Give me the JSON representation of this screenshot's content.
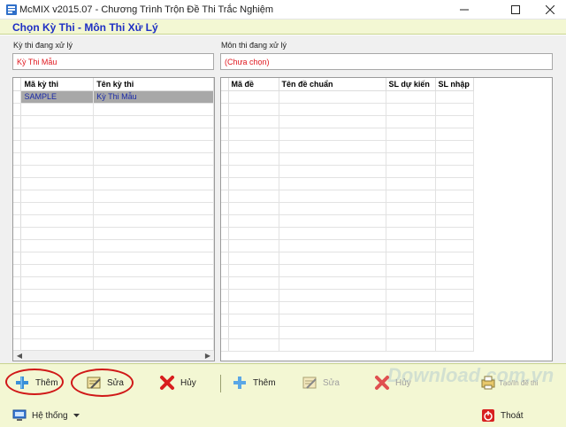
{
  "window": {
    "title": "McMIX v2015.07 - Chương Trình Trộn Đề Thi Trắc Nghiệm",
    "controls": [
      "minimize",
      "maximize",
      "close"
    ]
  },
  "header": {
    "title": "Chọn Kỳ Thi - Môn Thi Xử Lý"
  },
  "left_panel": {
    "label": "Kỳ thi đang xử lý",
    "current_value": "Kỳ Thi Mẫu",
    "columns": [
      "Mã kỳ thi",
      "Tên kỳ thi"
    ],
    "rows": [
      {
        "code": "SAMPLE",
        "name": "Kỳ Thi Mẫu",
        "selected": true
      }
    ]
  },
  "right_panel": {
    "label": "Môn thi đang xử lý",
    "current_value": "(Chưa chọn)",
    "columns": [
      "Mã đề",
      "Tên đề chuẩn",
      "SL dự kiến",
      "SL nhập"
    ],
    "rows": []
  },
  "toolbar": {
    "left": {
      "add": "Thêm",
      "edit": "Sửa",
      "delete": "Hủy"
    },
    "right": {
      "add": "Thêm",
      "edit": "Sửa",
      "delete": "Hủy",
      "print": "Tạo/In đề thi"
    }
  },
  "watermark": "Download.com.vn",
  "bottom": {
    "system": "Hệ thống",
    "exit": "Thoát"
  },
  "colors": {
    "header_bg": "#f3f7d3",
    "title_blue": "#1e2fc4",
    "value_red": "#e0181f",
    "annotation_red": "#d01818"
  },
  "icons": [
    "app-icon",
    "minimize-icon",
    "maximize-icon",
    "close-icon",
    "add-icon",
    "edit-icon",
    "delete-icon",
    "print-icon",
    "system-icon",
    "exit-icon"
  ]
}
